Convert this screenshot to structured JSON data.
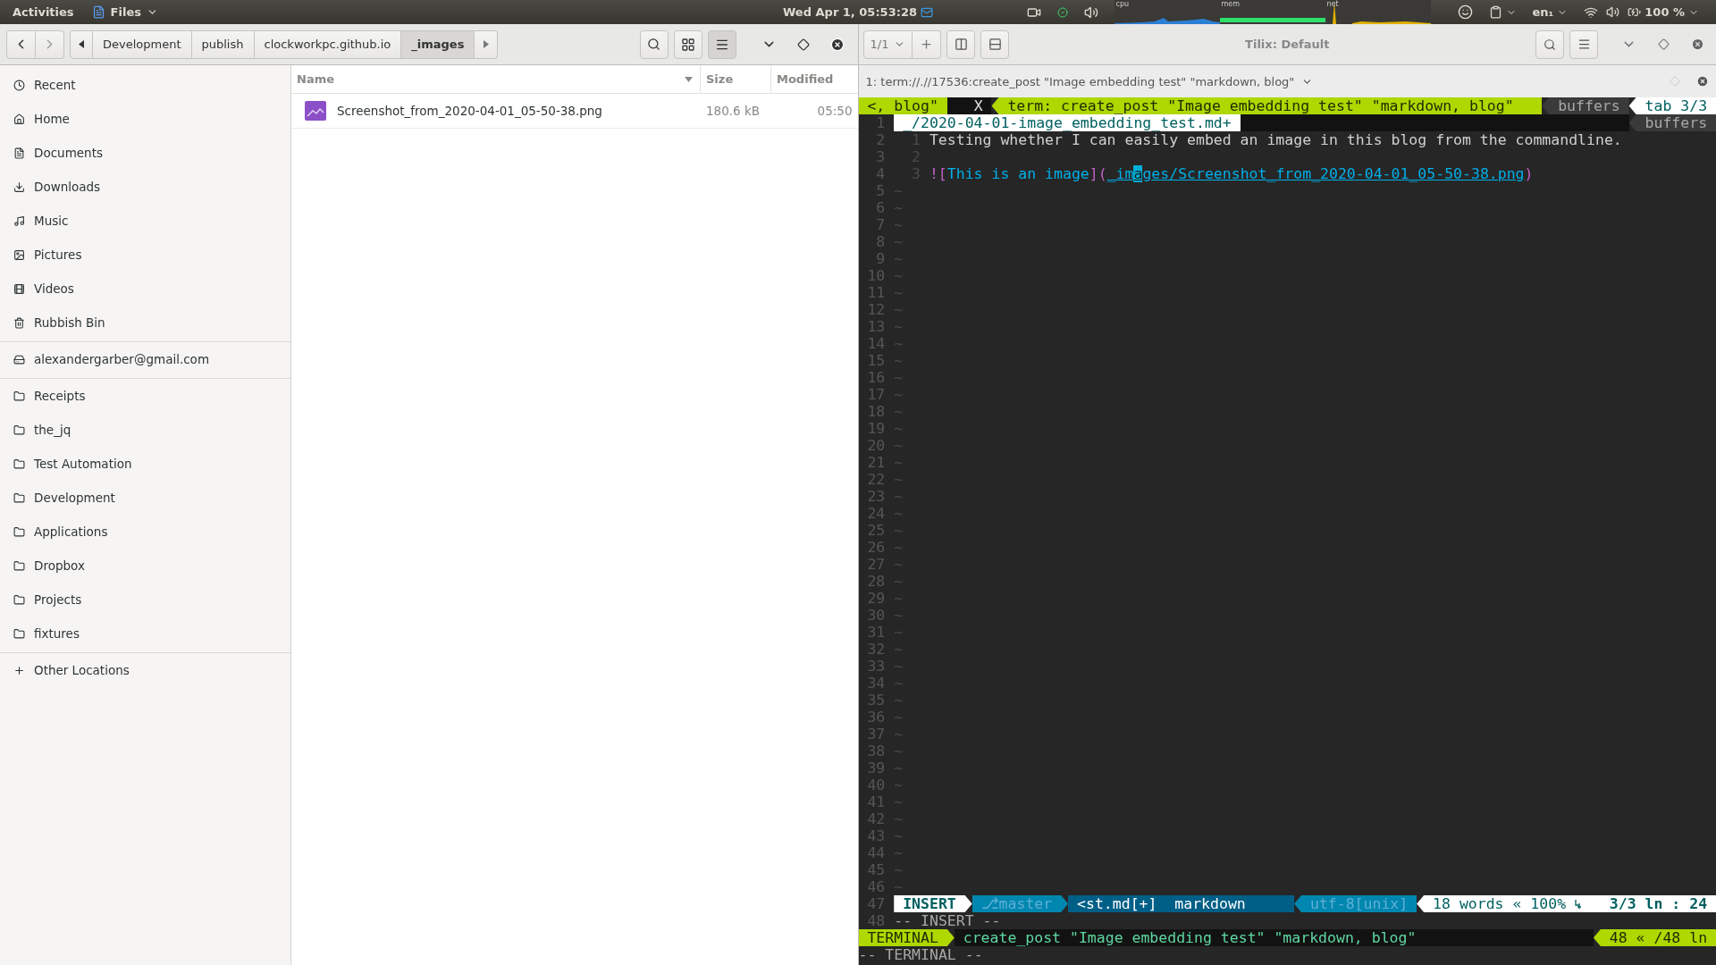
{
  "top_bar": {
    "activities": "Activities",
    "app_menu": "Files",
    "clock": "Wed Apr  1, 05:53:28",
    "graphs": [
      {
        "label": "cpu",
        "kind": "cpu"
      },
      {
        "label": "mem",
        "kind": "mem"
      },
      {
        "label": "net",
        "kind": "net"
      }
    ],
    "keyboard": "en₁",
    "battery": "100 %"
  },
  "files": {
    "path": [
      {
        "label": "Development",
        "selected": false
      },
      {
        "label": "publish",
        "selected": false
      },
      {
        "label": "clockworkpc.github.io",
        "selected": false
      },
      {
        "label": "_images",
        "selected": true
      }
    ],
    "view_buttons": [
      {
        "kind": "grid",
        "selected": false
      },
      {
        "kind": "list",
        "selected": true
      }
    ],
    "sidebar": [
      [
        {
          "kind": "recent",
          "label": "Recent"
        },
        {
          "kind": "home",
          "label": "Home"
        },
        {
          "kind": "documents",
          "label": "Documents"
        },
        {
          "kind": "downloads",
          "label": "Downloads"
        },
        {
          "kind": "music",
          "label": "Music"
        },
        {
          "kind": "pictures",
          "label": "Pictures"
        },
        {
          "kind": "videos",
          "label": "Videos"
        },
        {
          "kind": "trash",
          "label": "Rubbish Bin"
        }
      ],
      [
        {
          "kind": "account",
          "label": "alexandergarber@gmail.com"
        }
      ],
      [
        {
          "kind": "folder",
          "label": "Receipts"
        },
        {
          "kind": "folder",
          "label": "the_jq"
        },
        {
          "kind": "folder",
          "label": "Test Automation"
        },
        {
          "kind": "folder",
          "label": "Development"
        },
        {
          "kind": "folder",
          "label": "Applications"
        },
        {
          "kind": "folder",
          "label": "Dropbox"
        },
        {
          "kind": "folder",
          "label": "Projects"
        },
        {
          "kind": "folder",
          "label": "fixtures"
        }
      ],
      [
        {
          "kind": "other",
          "label": "Other Locations"
        }
      ]
    ],
    "columns": [
      "Name",
      "Size",
      "Modified"
    ],
    "rows": [
      {
        "name": "Screenshot_from_2020-04-01_05-50-38.png",
        "size": "180.6 kB",
        "modified": "05:50"
      }
    ]
  },
  "terminal": {
    "title": "Tilix: Default",
    "session": "1/1",
    "pane_title": "1: term://.//17536:create_post \"Image embedding test\" \"markdown, blog\"",
    "tabline": {
      "left": [
        {
          "kind": "tab",
          "text": "<, blog\""
        },
        {
          "kind": "close",
          "text": "X"
        }
      ],
      "current": "term: create_post \"Image embedding test\" \"markdown, blog\"",
      "right": [
        {
          "kind": "label",
          "text": "buffers"
        },
        {
          "kind": "count",
          "text": "tab 3/3"
        }
      ]
    },
    "rows": [
      {
        "number": "1",
        "kind": "inner_tabline",
        "file": "_/2020-04-01-image_embedding_test.md+",
        "buffers": "buffers"
      },
      {
        "number": "2",
        "kind": "code",
        "inner_number": "1",
        "segments": [
          {
            "kind": "plain",
            "text": "Testing whether I can easily embed an image in this blog from the commandline."
          }
        ]
      },
      {
        "number": "3",
        "kind": "code",
        "inner_number": "2"
      },
      {
        "number": "4",
        "kind": "code",
        "inner_number": "3",
        "segments": [
          {
            "kind": "punct",
            "text": "!["
          },
          {
            "kind": "link_text",
            "text": "This is an image"
          },
          {
            "kind": "punct",
            "text": "]("
          },
          {
            "kind": "url",
            "text": "_im"
          },
          {
            "kind": "cursor",
            "text": "a"
          },
          {
            "kind": "url",
            "text": "ges/Screenshot_from_2020-04-01_05-50-38.png"
          },
          {
            "kind": "punct",
            "text": ")"
          }
        ]
      },
      {
        "number": "5",
        "kind": "tilde",
        "text": "~"
      },
      {
        "number": "6",
        "kind": "tilde",
        "text": "~"
      },
      {
        "number": "7",
        "kind": "tilde",
        "text": "~"
      },
      {
        "number": "8",
        "kind": "tilde",
        "text": "~"
      },
      {
        "number": "9",
        "kind": "tilde",
        "text": "~"
      },
      {
        "number": "10",
        "kind": "tilde",
        "text": "~"
      },
      {
        "number": "11",
        "kind": "tilde",
        "text": "~"
      },
      {
        "number": "12",
        "kind": "tilde",
        "text": "~"
      },
      {
        "number": "13",
        "kind": "tilde",
        "text": "~"
      },
      {
        "number": "14",
        "kind": "tilde",
        "text": "~"
      },
      {
        "number": "15",
        "kind": "tilde",
        "text": "~"
      },
      {
        "number": "16",
        "kind": "tilde",
        "text": "~"
      },
      {
        "number": "17",
        "kind": "tilde",
        "text": "~"
      },
      {
        "number": "18",
        "kind": "tilde",
        "text": "~"
      },
      {
        "number": "19",
        "kind": "tilde",
        "text": "~"
      },
      {
        "number": "20",
        "kind": "tilde",
        "text": "~"
      },
      {
        "number": "21",
        "kind": "tilde",
        "text": "~"
      },
      {
        "number": "22",
        "kind": "tilde",
        "text": "~"
      },
      {
        "number": "23",
        "kind": "tilde",
        "text": "~"
      },
      {
        "number": "24",
        "kind": "tilde",
        "text": "~"
      },
      {
        "number": "25",
        "kind": "tilde",
        "text": "~"
      },
      {
        "number": "26",
        "kind": "tilde",
        "text": "~"
      },
      {
        "number": "27",
        "kind": "tilde",
        "text": "~"
      },
      {
        "number": "28",
        "kind": "tilde",
        "text": "~"
      },
      {
        "number": "29",
        "kind": "tilde",
        "text": "~"
      },
      {
        "number": "30",
        "kind": "tilde",
        "text": "~"
      },
      {
        "number": "31",
        "kind": "tilde",
        "text": "~"
      },
      {
        "number": "32",
        "kind": "tilde",
        "text": "~"
      },
      {
        "number": "33",
        "kind": "tilde",
        "text": "~"
      },
      {
        "number": "34",
        "kind": "tilde",
        "text": "~"
      },
      {
        "number": "35",
        "kind": "tilde",
        "text": "~"
      },
      {
        "number": "36",
        "kind": "tilde",
        "text": "~"
      },
      {
        "number": "37",
        "kind": "tilde",
        "text": "~"
      },
      {
        "number": "38",
        "kind": "tilde",
        "text": "~"
      },
      {
        "number": "39",
        "kind": "tilde",
        "text": "~"
      },
      {
        "number": "40",
        "kind": "tilde",
        "text": "~"
      },
      {
        "number": "41",
        "kind": "tilde",
        "text": "~"
      },
      {
        "number": "42",
        "kind": "tilde",
        "text": "~"
      },
      {
        "number": "43",
        "kind": "tilde",
        "text": "~"
      },
      {
        "number": "44",
        "kind": "tilde",
        "text": "~"
      },
      {
        "number": "45",
        "kind": "tilde",
        "text": "~"
      },
      {
        "number": "46",
        "kind": "tilde",
        "text": "~"
      },
      {
        "number": "47",
        "kind": "status",
        "segments": [
          {
            "kind": "mode",
            "text": "INSERT"
          },
          {
            "kind": "branch",
            "text": "⎇master"
          },
          {
            "kind": "file",
            "text": "<st.md[+]"
          },
          {
            "kind": "filetype",
            "text": "markdown"
          },
          {
            "kind": "encoding",
            "text": "utf-8[unix]"
          },
          {
            "kind": "stats",
            "text": "18 words « 100%"
          },
          {
            "kind": "eol"
          },
          {
            "kind": "position",
            "text": "3/3 ln : 24"
          }
        ]
      },
      {
        "number": "48",
        "kind": "message",
        "text": "-- INSERT --"
      }
    ],
    "statusline": {
      "mode": "TERMINAL",
      "title": "create_post \"Image embedding test\" \"markdown, blog\"",
      "position": "48 « /48 ln"
    },
    "message": "-- TERMINAL --"
  }
}
